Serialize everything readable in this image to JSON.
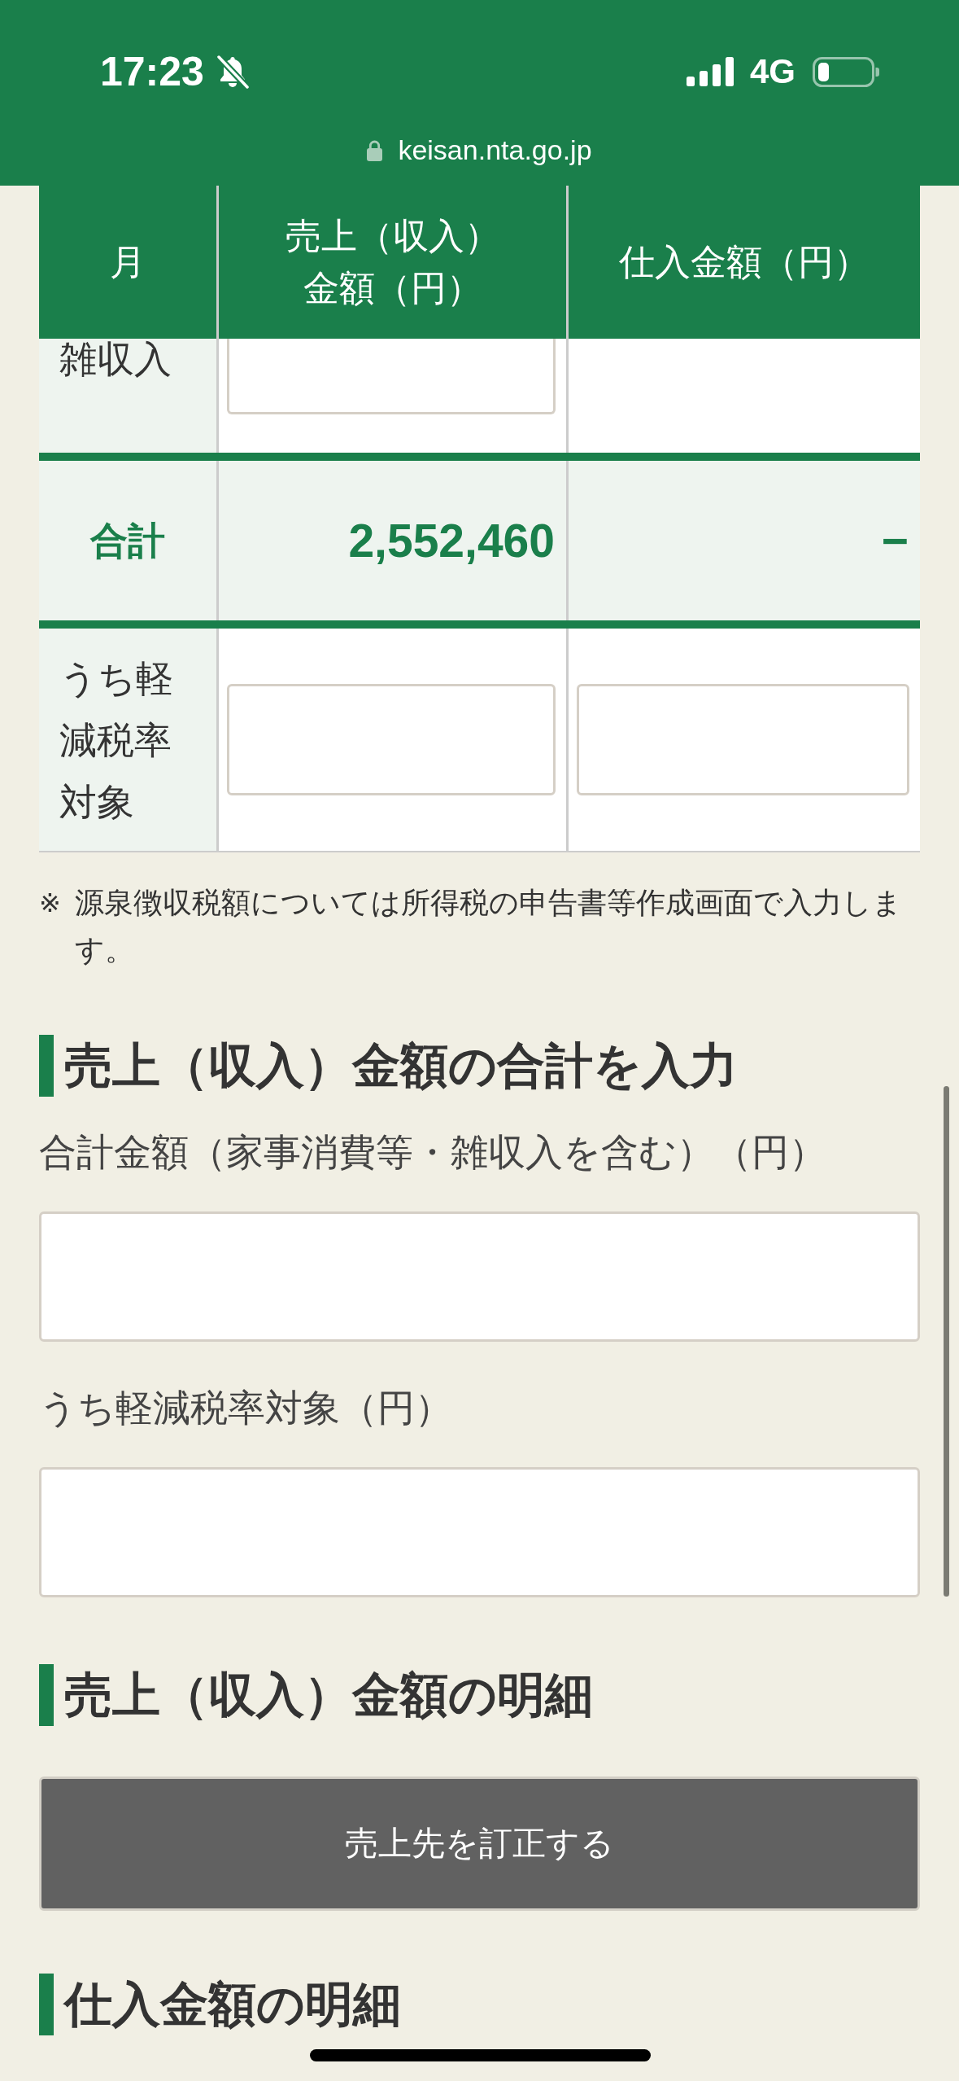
{
  "status_bar": {
    "time": "17:23",
    "network": "4G"
  },
  "address_bar": {
    "url": "keisan.nta.go.jp"
  },
  "table": {
    "columns": [
      "月",
      "売上（収入）金額（円）",
      "仕入金額（円）"
    ],
    "rows": [
      {
        "kind": "input",
        "cells": [
          {
            "kind": "label",
            "value": "雑収入"
          },
          {
            "kind": "field"
          },
          {
            "kind": "empty"
          }
        ]
      },
      {
        "kind": "total",
        "cells": [
          {
            "kind": "label",
            "value": "合計"
          },
          {
            "kind": "text",
            "value": "2,552,460"
          },
          {
            "kind": "text",
            "value": "−"
          }
        ]
      },
      {
        "kind": "input",
        "cells": [
          {
            "kind": "label",
            "value": "うち軽減税率対象"
          },
          {
            "kind": "field"
          },
          {
            "kind": "field"
          }
        ]
      }
    ]
  },
  "note": {
    "mark": "※",
    "text": "源泉徴収税額については所得税の申告書等作成画面で入力します。"
  },
  "sections": [
    {
      "heading": "売上（収入）金額の合計を入力",
      "fields": [
        {
          "label": "合計金額（家事消費等・雑収入を含む）（円）"
        },
        {
          "label": "うち軽減税率対象（円）"
        }
      ]
    },
    {
      "heading": "売上（収入）金額の明細",
      "buttons": [
        "売上先を訂正する"
      ]
    },
    {
      "heading": "仕入金額の明細"
    }
  ]
}
